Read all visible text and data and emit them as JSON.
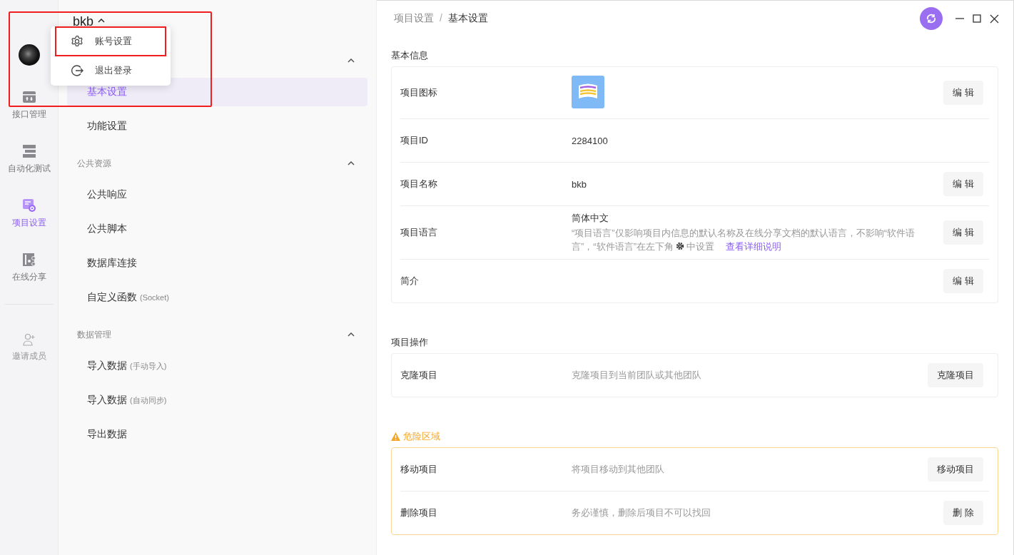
{
  "rail": {
    "items": [
      {
        "label": "接口管理",
        "kind": "api",
        "selected": false
      },
      {
        "label": "自动化测试",
        "kind": "automation",
        "selected": false
      },
      {
        "label": "项目设置",
        "kind": "settings",
        "selected": true
      },
      {
        "label": "在线分享",
        "kind": "share",
        "selected": false
      }
    ],
    "invite": {
      "label": "邀请成员"
    }
  },
  "nav": {
    "project_title": "bkb",
    "groups": [
      {
        "expanded": true,
        "items": [
          {
            "label": "基本设置",
            "selected": true
          },
          {
            "label": "功能设置",
            "selected": false
          }
        ]
      },
      {
        "title": "公共资源",
        "expanded": true,
        "items": [
          {
            "label": "公共响应",
            "selected": false
          },
          {
            "label": "公共脚本",
            "selected": false
          },
          {
            "label": "数据库连接",
            "selected": false
          },
          {
            "label": "自定义函数",
            "note": "(Socket)",
            "selected": false
          }
        ]
      },
      {
        "title": "数据管理",
        "expanded": true,
        "items": [
          {
            "label": "导入数据",
            "note": "(手动导入)",
            "selected": false
          },
          {
            "label": "导入数据",
            "note": "(自动同步)",
            "selected": false
          },
          {
            "label": "导出数据",
            "selected": false
          }
        ]
      }
    ]
  },
  "popup_menu": {
    "items": [
      {
        "label": "账号设置",
        "kind": "gear",
        "highlighted": true
      },
      {
        "label": "退出登录",
        "kind": "logout",
        "highlighted": false
      }
    ]
  },
  "breadcrumb": [
    "项目设置",
    "基本设置"
  ],
  "breadcrumb_separator": "/",
  "sections": [
    {
      "title": "基本信息",
      "kind": "normal",
      "rows": [
        {
          "label": "项目图标",
          "kind": "icon",
          "button": "编 辑"
        },
        {
          "label": "项目ID",
          "kind": "text",
          "value": "2284100"
        },
        {
          "label": "项目名称",
          "kind": "text",
          "value": "bkb",
          "button": "编 辑"
        },
        {
          "label": "项目语言",
          "kind": "language",
          "value": "简体中文",
          "note_before": "“项目语言”仅影响项目内信息的默认名称及在线分享文档的默认语言，不影响“软件语言”，“软件语言”在左下角",
          "note_after": "中设置",
          "link": "查看详细说明",
          "button": "编 辑"
        },
        {
          "label": "简介",
          "kind": "text",
          "button": "编 辑"
        }
      ]
    },
    {
      "title": "项目操作",
      "kind": "normal",
      "rows": [
        {
          "label": "克隆项目",
          "kind": "hint",
          "value": "克隆项目到当前团队或其他团队",
          "button": "克隆项目"
        }
      ]
    },
    {
      "title": "危险区域",
      "kind": "danger",
      "rows": [
        {
          "label": "移动项目",
          "kind": "hint",
          "value": "将项目移动到其他团队",
          "button": "移动项目"
        },
        {
          "label": "删除项目",
          "kind": "hint",
          "value": "务必谨慎，删除后项目不可以找回",
          "button": "删 除"
        }
      ]
    }
  ]
}
